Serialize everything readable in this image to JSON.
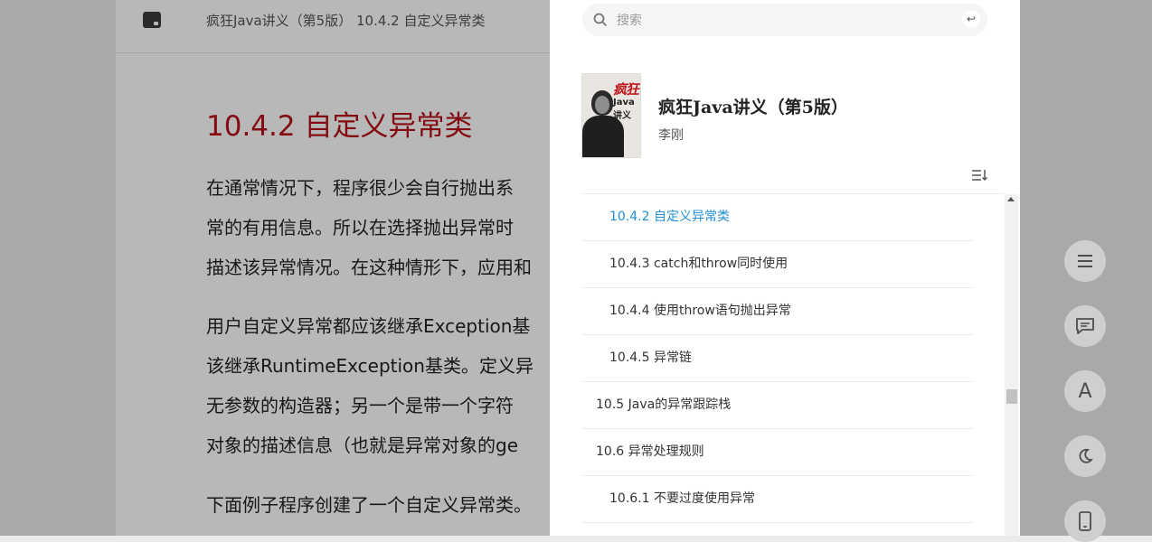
{
  "reader": {
    "header_title": "疯狂Java讲义（第5版） 10.4.2 自定义异常类",
    "heading": "10.4.2 自定义异常类",
    "paragraphs": [
      [
        "在通常情况下，程序很少会自行抛出系",
        "常的有用信息。所以在选择抛出异常时",
        "描述该异常情况。在这种情形下，应用和"
      ],
      [
        "用户自定义异常都应该继承Exception基",
        "该继承RuntimeException基类。定义异",
        "无参数的构造器；另一个是带一个字符",
        "对象的描述信息（也就是异常对象的ge"
      ],
      [
        "下面例子程序创建了一个自定义异常类。"
      ]
    ]
  },
  "search": {
    "placeholder": "搜索",
    "enter_key": "↩"
  },
  "book": {
    "title": "疯狂Java讲义（第5版）",
    "author": "李刚",
    "cover_title": "疯狂",
    "cover_subtitle": "Java讲义"
  },
  "toc": [
    {
      "label": "10.4.2 自定义异常类",
      "level": 2,
      "active": true
    },
    {
      "label": "10.4.3 catch和throw同时使用",
      "level": 2,
      "active": false
    },
    {
      "label": "10.4.4 使用throw语句抛出异常",
      "level": 2,
      "active": false
    },
    {
      "label": "10.4.5 异常链",
      "level": 2,
      "active": false
    },
    {
      "label": "10.5 Java的异常跟踪栈",
      "level": 1,
      "active": false
    },
    {
      "label": "10.6 异常处理规则",
      "level": 1,
      "active": false
    },
    {
      "label": "10.6.1 不要过度使用异常",
      "level": 2,
      "active": false
    }
  ],
  "fabs": {
    "font_label": "A"
  },
  "icons": [
    "book-icon",
    "search-icon",
    "enter-key-icon",
    "toc-sort-icon",
    "menu-icon",
    "comment-icon",
    "font-icon",
    "moon-icon",
    "phone-icon"
  ],
  "colors": {
    "accent": "#1e8fd6",
    "heading_red": "#b8101a"
  }
}
